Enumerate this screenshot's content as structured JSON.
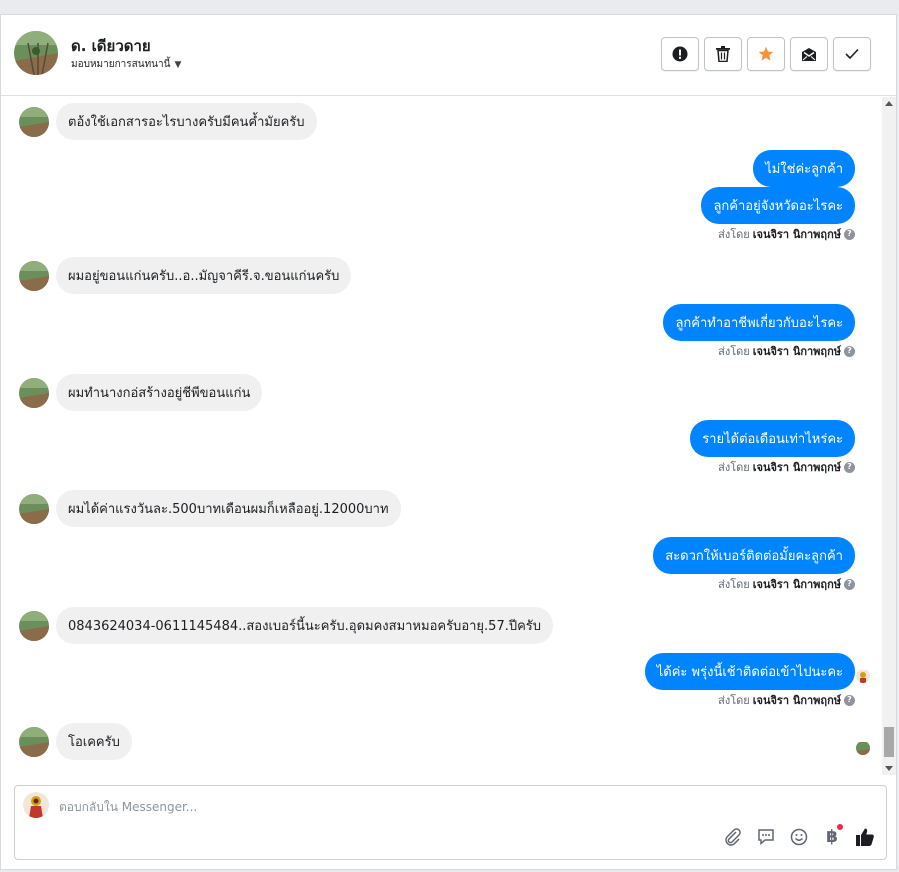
{
  "header": {
    "contact_name": "ด. เดียวดาย",
    "assign_label": "มอบหมายการสนทนานี้",
    "buttons": [
      {
        "name": "mark-spam-button",
        "icon": "exclamation-icon"
      },
      {
        "name": "delete-button",
        "icon": "trash-icon"
      },
      {
        "name": "star-button",
        "icon": "star-icon"
      },
      {
        "name": "mark-unread-button",
        "icon": "envelope-icon"
      },
      {
        "name": "mark-done-button",
        "icon": "checkmark-icon"
      }
    ]
  },
  "messages": [
    {
      "from": "customer",
      "text": "ตอ้งใช้เอกสารอะไรบางครับมีคนค้ำมัยครับ"
    },
    {
      "from": "page",
      "text": "ไม่ใช่ค่ะลูกค้า"
    },
    {
      "from": "page",
      "text": "ลูกค้าอยู่จังหวัดอะไรคะ"
    },
    {
      "from": "page_meta",
      "prefix": "ส่งโดย",
      "sender": "เจนจิรา นิกาพฤกษ์"
    },
    {
      "from": "customer",
      "text": "ผมอยู่ขอนแก่นครับ..อ..มัญจาคีรี.จ.ขอนแก่นครับ"
    },
    {
      "from": "page",
      "text": "ลูกค้าทำอาชีพเกี่ยวกับอะไรคะ"
    },
    {
      "from": "page_meta",
      "prefix": "ส่งโดย",
      "sender": "เจนจิรา นิกาพฤกษ์"
    },
    {
      "from": "customer",
      "text": "ผมทำนางกอ่สร้างอยู่ชีพีขอนแก่น"
    },
    {
      "from": "page",
      "text": "รายได้ต่อเดือนเท่าไหร่คะ"
    },
    {
      "from": "page_meta",
      "prefix": "ส่งโดย",
      "sender": "เจนจิรา นิกาพฤกษ์"
    },
    {
      "from": "customer",
      "text": "ผมได้ค่าแรงวันละ.500บาทเดือนผมก็เหลืออยู่.12000บาท"
    },
    {
      "from": "page",
      "text": "สะดวกให้เบอร์ติดต่อมั้ยคะลูกค้า"
    },
    {
      "from": "page_meta",
      "prefix": "ส่งโดย",
      "sender": "เจนจิรา นิกาพฤกษ์"
    },
    {
      "from": "customer",
      "text": "0843624034-0611145484..สองเบอร์นี้นะครับ.อุดมคงสมาหมอครับอายุ.57.ปีครับ"
    },
    {
      "from": "page",
      "text": "ได้ค่ะ พรุ่งนี้เช้าติดต่อเข้าไปนะคะ"
    },
    {
      "from": "page_meta",
      "prefix": "ส่งโดย",
      "sender": "เจนจิรา นิกาพฤกษ์"
    },
    {
      "from": "customer",
      "text": "โอเคครับ"
    }
  ],
  "composer": {
    "placeholder": "ตอบกลับใน Messenger...",
    "icons": [
      "paperclip-icon",
      "saved-reply-icon",
      "emoji-icon",
      "baht-payment-icon",
      "thumbs-up-icon"
    ],
    "baht_symbol": "฿"
  },
  "colors": {
    "accent": "#0084ff",
    "incoming_bubble": "#f0f0f0",
    "star": "#f7923b"
  }
}
